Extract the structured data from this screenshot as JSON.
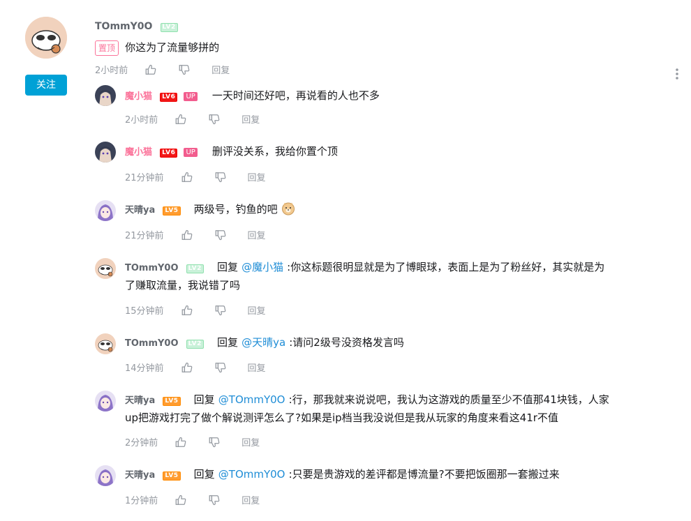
{
  "root": {
    "username": "TOmmY0O",
    "level": "LV2",
    "pin_label": "置顶",
    "text": "你这为了流量够拼的",
    "time": "2小时前",
    "reply_label": "回复",
    "follow_label": "关注"
  },
  "replies": [
    {
      "username": "魔小猫",
      "level": "LV6",
      "up": "UP",
      "text": "一天时间还好吧，再说看的人也不多",
      "time": "2小时前",
      "reply_label": "回复"
    },
    {
      "username": "魔小猫",
      "level": "LV6",
      "up": "UP",
      "text": "删评没关系，我给你置个顶",
      "time": "21分钟前",
      "reply_label": "回复"
    },
    {
      "username": "天晴ya",
      "level": "LV5",
      "text": "两级号，钓鱼的吧",
      "time": "21分钟前",
      "reply_label": "回复"
    },
    {
      "username": "TOmmY0O",
      "level": "LV2",
      "reply_prefix": "回复",
      "mention": "@魔小猫",
      "text_line1": ":你这标题很明显就是为了博眼球，表面上是为了粉丝好，其实就是为",
      "text_line2": "了赚取流量，我说错了吗",
      "time": "15分钟前",
      "reply_label": "回复"
    },
    {
      "username": "TOmmY0O",
      "level": "LV2",
      "reply_prefix": "回复",
      "mention": "@天晴ya",
      "text": ":请问2级号没资格发言吗",
      "time": "14分钟前",
      "reply_label": "回复"
    },
    {
      "username": "天晴ya",
      "level": "LV5",
      "reply_prefix": "回复",
      "mention": "@TOmmY0O",
      "text_line1": ":行，那我就来说说吧，我认为这游戏的质量至少不值那41块钱，人家",
      "text_line2": "up把游戏打完了做个解说测评怎么了?如果是ip档当我没说但是我从玩家的角度来看这41r不值",
      "time": "2分钟前",
      "reply_label": "回复"
    },
    {
      "username": "天晴ya",
      "level": "LV5",
      "reply_prefix": "回复",
      "mention": "@TOmmY0O",
      "text": ":只要是贵游戏的差评都是博流量?不要把饭圈那一套搬过来",
      "time": "1分钟前",
      "reply_label": "回复"
    }
  ],
  "colors": {
    "accent": "#00a1d6",
    "vip": "#fb7299",
    "mention": "#1f8dd6",
    "meta": "#9499a0"
  }
}
